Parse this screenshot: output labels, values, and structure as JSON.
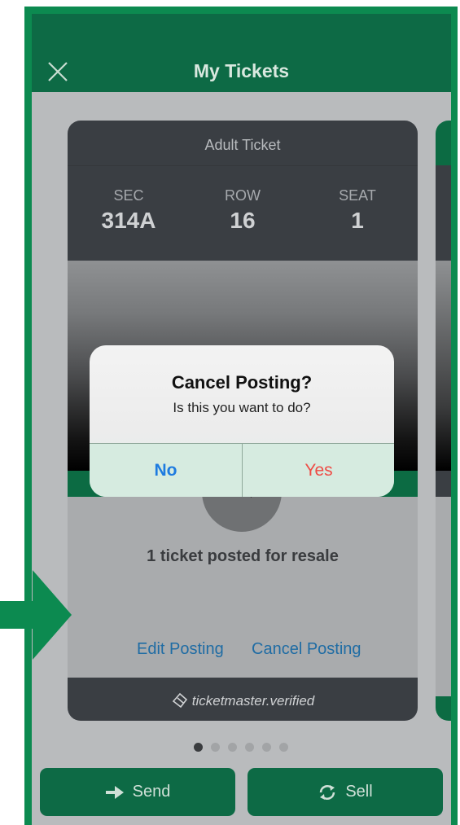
{
  "header": {
    "title": "My Tickets"
  },
  "ticket": {
    "type": "Adult Ticket",
    "sec_label": "SEC",
    "sec_value": "314A",
    "row_label": "ROW",
    "row_value": "16",
    "seat_label": "SEAT",
    "seat_value": "1",
    "status": "1 ticket posted for resale",
    "edit_posting": "Edit Posting",
    "cancel_posting": "Cancel Posting",
    "footer": "ticketmaster.verified"
  },
  "pagination": {
    "total": 6,
    "active": 1
  },
  "bottom_bar": {
    "send_label": "Send",
    "sell_label": "Sell"
  },
  "dialog": {
    "title": "Cancel Posting?",
    "message": "Is this you want to do?",
    "no_label": "No",
    "yes_label": "Yes"
  },
  "colors": {
    "brand_green": "#0d6a45",
    "card_dark": "#3a3e43",
    "link_blue": "#1f6ca4",
    "yes_red": "#ef4b45",
    "no_blue": "#1e7be0"
  }
}
